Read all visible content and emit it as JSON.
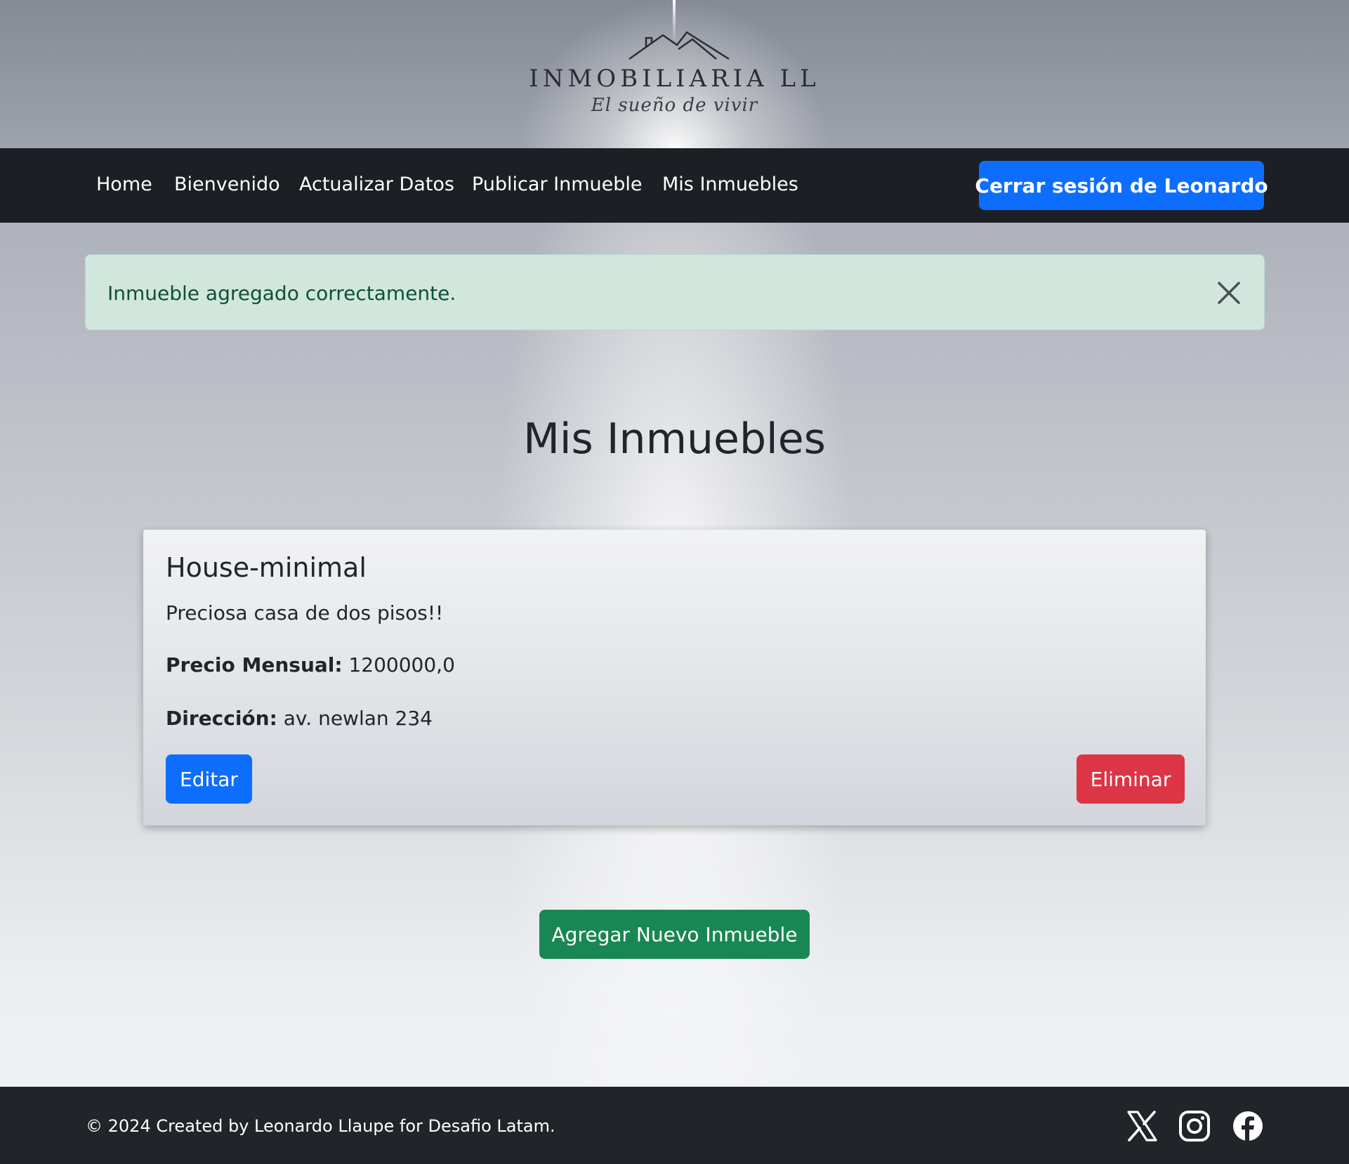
{
  "brand": {
    "name": "INMOBILIARIA LL",
    "tagline": "El sueño de vivir"
  },
  "nav": {
    "links": [
      {
        "label": "Home"
      },
      {
        "label": "Bienvenido"
      },
      {
        "label": "Actualizar Datos"
      },
      {
        "label": "Publicar Inmueble"
      },
      {
        "label": "Mis Inmuebles"
      }
    ],
    "logout_label": "Cerrar sesión de Leonardo"
  },
  "alert": {
    "message": "Inmueble agregado correctamente.",
    "close_icon": "close-icon"
  },
  "page": {
    "title": "Mis Inmuebles"
  },
  "properties": [
    {
      "title": "House-minimal",
      "description": "Preciosa casa de dos pisos!!",
      "price_label": "Precio Mensual:",
      "price_value": "1200000,0",
      "address_label": "Dirección:",
      "address_value": "av. newlan 234",
      "edit_label": "Editar",
      "delete_label": "Eliminar"
    }
  ],
  "actions": {
    "add_label": "Agregar Nuevo Inmueble"
  },
  "footer": {
    "text": "© 2024 Created by Leonardo Llaupe for Desafio Latam.",
    "social_icons": [
      "x-icon",
      "instagram-icon",
      "facebook-icon"
    ]
  },
  "colors": {
    "primary": "#0d6efd",
    "danger": "#dc3545",
    "success": "#198754",
    "dark": "#212529",
    "alert_bg": "#d1e7dd",
    "alert_text": "#0f5132"
  }
}
